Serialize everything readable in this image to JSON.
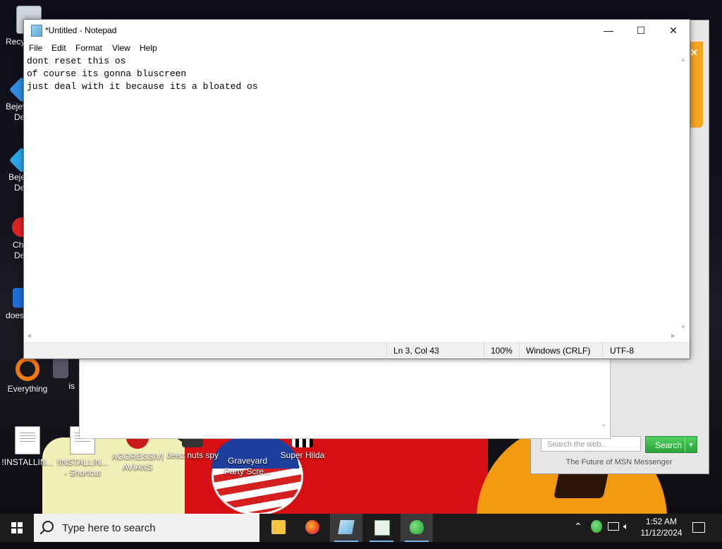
{
  "notepad": {
    "title": "*Untitled - Notepad",
    "menu": [
      "File",
      "Edit",
      "Format",
      "View",
      "Help"
    ],
    "lines": [
      "dont reset this os",
      "of course its gonna bluscreen",
      "just deal with it because its a bloated os"
    ],
    "status": {
      "position": "Ln 3, Col 43",
      "zoom": "100%",
      "line_ending": "Windows (CRLF)",
      "encoding": "UTF-8"
    }
  },
  "desktop_icons": [
    {
      "label": "Recy",
      "icon": "recycle-bin-icon"
    },
    {
      "label": "Bejev",
      "label2": "De",
      "icon": "bejeweled-icon"
    },
    {
      "label": "Beje",
      "label2": "De",
      "icon": "bejeweled-icon"
    },
    {
      "label": "Ch",
      "label2": "De",
      "icon": "chrome-icon"
    },
    {
      "label": "does",
      "icon": "app-icon"
    },
    {
      "label": "Everything",
      "icon": "everything-search-icon"
    },
    {
      "label": "is",
      "icon": "shield-icon"
    },
    {
      "label": "!INSTALLIN...",
      "icon": "text-file-icon"
    },
    {
      "label": "!INSTALLIN...",
      "label2": "- Shortcut",
      "icon": "text-file-icon"
    },
    {
      "label": "AGGRESSIVE",
      "label2": "AVIANS",
      "icon": "angry-bird-icon"
    },
    {
      "label": "deez nuts spy",
      "icon": "app-icon"
    },
    {
      "label": "Graveyard",
      "label2": "Party Scre...",
      "icon": "vote-badge-icon"
    },
    {
      "label": "Super Hilda",
      "icon": "game-icon"
    }
  ],
  "msn": {
    "search_placeholder": "Search the web...",
    "search_button": "Search",
    "footer": "The Future of MSN Messenger"
  },
  "taskbar": {
    "search_placeholder": "Type here to search",
    "apps": [
      "file-explorer-icon",
      "firefox-icon",
      "notepad-icon",
      "app-window-icon",
      "msn-messenger-icon"
    ],
    "time": "1:52 AM",
    "date": "11/12/2024"
  },
  "colors": {
    "msn_green": "#2aa33a",
    "taskbar": "#1c1c1c",
    "pumpkin": "#f39a10",
    "wallpaper_red": "#d60f12"
  }
}
